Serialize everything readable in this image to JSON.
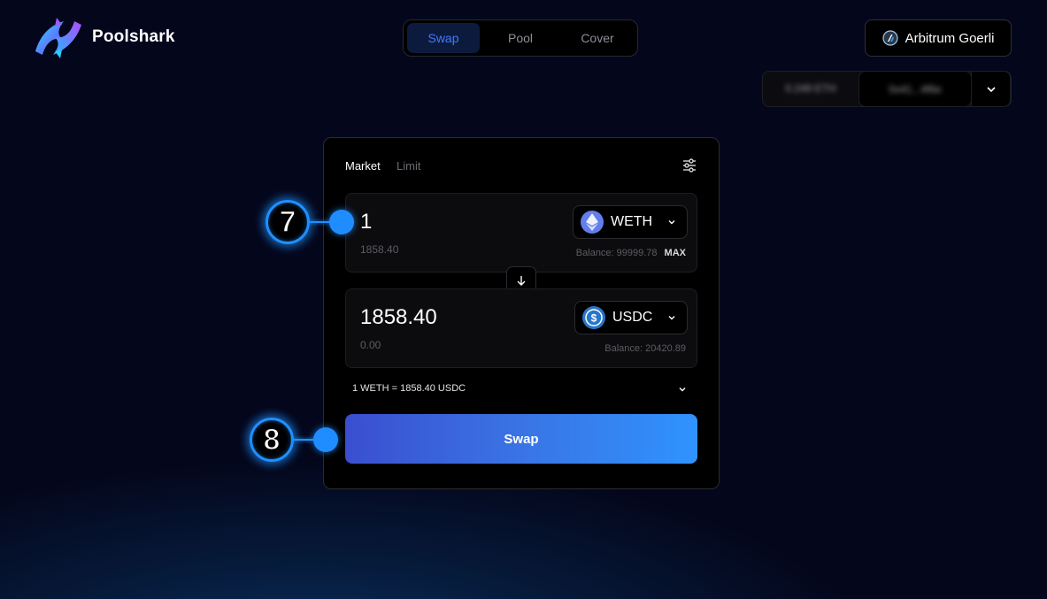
{
  "brand": {
    "name": "Poolshark",
    "logo_icon": "poolshark-logo"
  },
  "nav": {
    "tabs": [
      {
        "label": "Swap",
        "active": true
      },
      {
        "label": "Pool",
        "active": false
      },
      {
        "label": "Cover",
        "active": false
      }
    ]
  },
  "network": {
    "label": "Arbitrum Goerli",
    "icon": "arbitrum-icon"
  },
  "wallet": {
    "balance": "0.249 ETH",
    "address": "0x41...4f6e",
    "chevron_icon": "chevron-down-icon"
  },
  "swap": {
    "modes": [
      {
        "label": "Market",
        "active": true
      },
      {
        "label": "Limit",
        "active": false
      }
    ],
    "settings_icon": "settings-sliders-icon",
    "from": {
      "amount": "1",
      "usd": "1858.40",
      "token": "WETH",
      "token_icon": "ethereum-icon",
      "balance": "Balance: 99999.78",
      "max": "MAX"
    },
    "flip_icon": "arrow-down-icon",
    "to": {
      "amount": "1858.40",
      "usd": "0.00",
      "token": "USDC",
      "token_icon": "usdc-icon",
      "balance": "Balance: 20420.89"
    },
    "rate": "1 WETH = 1858.40 USDC",
    "button": "Swap"
  },
  "markers": [
    {
      "number": "7"
    },
    {
      "number": "8"
    }
  ],
  "colors": {
    "accent": "#3f7bff",
    "marker": "#1e90ff",
    "eth": "#627eea",
    "usdc": "#2775ca"
  }
}
